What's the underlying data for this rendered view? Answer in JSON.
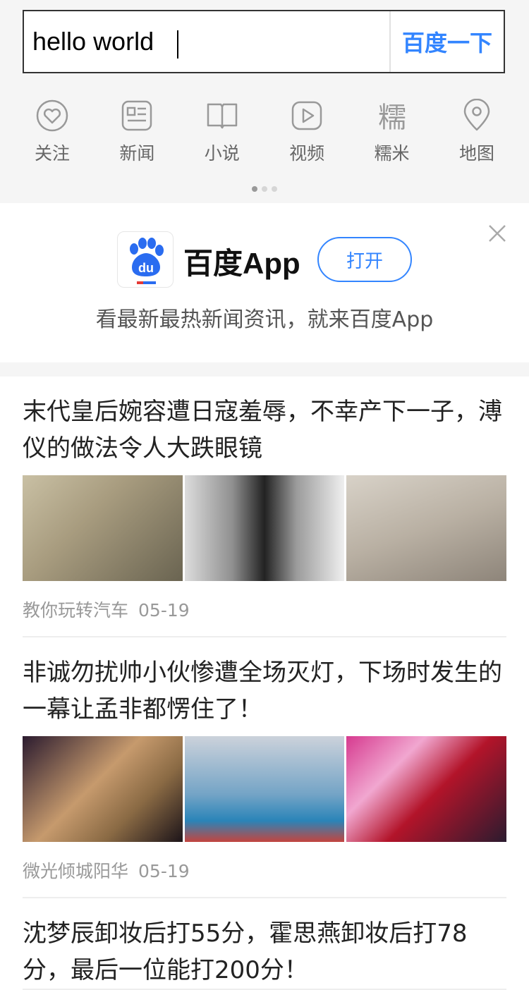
{
  "search": {
    "value": "hello world",
    "button_label": "百度一下"
  },
  "quick_nav": [
    {
      "label": "关注",
      "icon": "heart-icon"
    },
    {
      "label": "新闻",
      "icon": "news-icon"
    },
    {
      "label": "小说",
      "icon": "book-icon"
    },
    {
      "label": "视频",
      "icon": "video-play-icon"
    },
    {
      "label": "糯米",
      "icon": "nuomi-icon"
    },
    {
      "label": "地图",
      "icon": "map-pin-icon"
    }
  ],
  "pager": {
    "pages": 3,
    "active": 1
  },
  "promo": {
    "app_name": "百度App",
    "open_label": "打开",
    "slogan": "看最新最热新闻资讯，就来百度App",
    "logo_text": "du"
  },
  "colors": {
    "accent": "#3385ff",
    "background": "#f5f5f5",
    "border": "#333333"
  },
  "news": [
    {
      "title": "末代皇后婉容遭日寇羞辱，不幸产下一子，溥仪的做法令人大跌眼镜",
      "source": "教你玩转汽车",
      "date": "05-19"
    },
    {
      "title": "非诚勿扰帅小伙惨遭全场灭灯，下场时发生的一幕让孟非都愣住了！",
      "source": "微光倾城阳华",
      "date": "05-19"
    },
    {
      "title": "沈梦辰卸妆后打55分，霍思燕卸妆后打78分，最后一位能打200分！",
      "source": "",
      "date": ""
    }
  ]
}
